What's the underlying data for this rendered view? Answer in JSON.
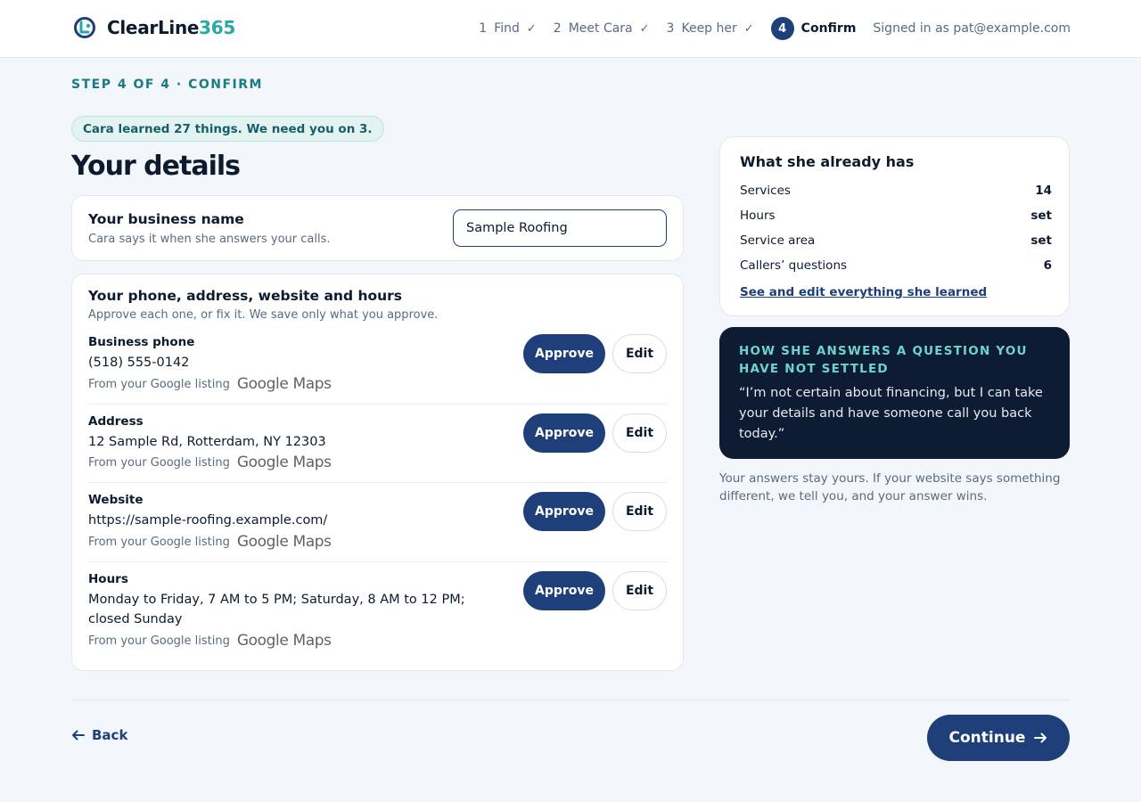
{
  "brand": {
    "name": "ClearLine",
    "suffix": "365",
    "accent": "#2aa9a4",
    "primary": "#1e3f7a"
  },
  "steps": [
    {
      "number": "1",
      "label": "Find",
      "status": "✓"
    },
    {
      "number": "2",
      "label": "Meet Cara",
      "status": "✓"
    },
    {
      "number": "3",
      "label": "Keep her",
      "status": "✓"
    },
    {
      "number": "4",
      "label": "Confirm",
      "status": "active"
    }
  ],
  "signed_in": "Signed in as pat@example.com",
  "page": {
    "eyebrow": "STEP 4 OF 4 · CONFIRM",
    "pill": "Cara learned 27 things. We need you on 3.",
    "title": "Your details"
  },
  "business_name": {
    "title": "Your business name",
    "subtitle": "Cara says it when she answers your calls.",
    "value": "Sample Roofing"
  },
  "details": {
    "title": "Your phone, address, website and hours",
    "subtitle": "Approve each one, or fix it. We save only what you approve.",
    "approve_label": "Approve",
    "edit_label": "Edit",
    "source_label": "From your Google listing",
    "source_brand": "Google Maps",
    "items": [
      {
        "label": "Business phone",
        "value": "(518) 555-0142"
      },
      {
        "label": "Address",
        "value": "12 Sample Rd, Rotterdam, NY 12303"
      },
      {
        "label": "Website",
        "value": "https://sample-roofing.example.com/"
      },
      {
        "label": "Hours",
        "value": "Monday to Friday, 7 AM to 5 PM; Saturday, 8 AM to 12 PM; closed Sunday"
      }
    ]
  },
  "already_has": {
    "title": "What she already has",
    "stats": [
      {
        "label": "Services",
        "value": "14"
      },
      {
        "label": "Hours",
        "value": "set"
      },
      {
        "label": "Service area",
        "value": "set"
      },
      {
        "label": "Callers’ questions",
        "value": "6"
      }
    ],
    "link": "See and edit everything she learned"
  },
  "unsettled": {
    "eyebrow": "HOW SHE ANSWERS A QUESTION YOU HAVE NOT SETTLED",
    "quote": "“I’m not certain about financing, but I can take your details and have someone call you back today.”"
  },
  "note": "Your answers stay yours. If your website says something different, we tell you, and your answer wins.",
  "footer": {
    "back_label": "Back",
    "continue_label": "Continue"
  }
}
